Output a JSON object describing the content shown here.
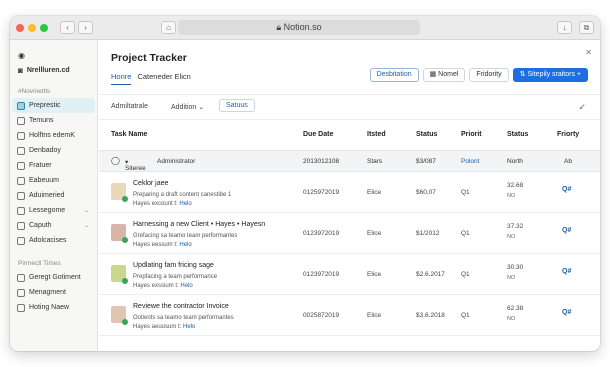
{
  "browser": {
    "url": "Notion.so",
    "lock_icon": "lock-icon"
  },
  "sidebar": {
    "workspace": "Nrellluren.cd",
    "section1": "#Novinettls",
    "items": [
      {
        "label": "Preprestic",
        "active": true
      },
      {
        "label": "Temuns"
      },
      {
        "label": "Holftns edemK"
      },
      {
        "label": "Denbadoy"
      },
      {
        "label": "Fratuer"
      },
      {
        "label": "Eabeuum"
      },
      {
        "label": "Aduimeried"
      },
      {
        "label": "Lessegome"
      },
      {
        "label": "Caputh"
      },
      {
        "label": "Adolcacises"
      }
    ],
    "section2": "Pirmectl Times",
    "items2": [
      {
        "label": "Geregt Gotiment"
      },
      {
        "label": "Menagment"
      },
      {
        "label": "Hoting Naew"
      }
    ]
  },
  "header": {
    "title": "Project Tracker",
    "views": [
      "Honre",
      "Cateneder Elicn"
    ],
    "buttons": [
      "Desbitation",
      "Nomel",
      "Fridority",
      "Sitepily sraitors +"
    ]
  },
  "toolbar": {
    "items": [
      "Admiltatrale",
      "Addition",
      "Satuus"
    ]
  },
  "table": {
    "columns": [
      "Task Name",
      "Due Date",
      "Itsted",
      "Status",
      "Priorit",
      "Status",
      "Friorty"
    ],
    "summary": {
      "name": "Siteree",
      "assignee": "Administrator",
      "date": "2013012108",
      "owner": "Stars",
      "status": "$3/087",
      "priority": "Polont",
      "status2": "North",
      "priority2": "Ab"
    },
    "rows": [
      {
        "title": "Ceklor jaee",
        "sub": "Preparing a draft content canestibe 1",
        "sub2_prefix": "Hayes excount t:",
        "sub2_link": "Helo",
        "date": "0125972019",
        "owner": "Elice",
        "status": "$60,07",
        "priority": "Q1",
        "status2_top": "32.68",
        "status2_bot": "NO",
        "priority2": "Q#",
        "thumb_color": "#e9d9b8"
      },
      {
        "title": "Harnessing a new Client • Hayes • Hayesn",
        "sub": "Grefacing sa teamo team performantes",
        "sub2_prefix": "Hayes eessum t:",
        "sub2_link": "Helo",
        "date": "0123972019",
        "owner": "Elice",
        "status": "$1/2012",
        "priority": "Q1",
        "status2_top": "37.32",
        "status2_bot": "NO",
        "priority2": "Q#",
        "thumb_color": "#d7b6a8"
      },
      {
        "title": "Updlating fam fricing sage",
        "sub": "Prepfacing a team performance",
        "sub2_prefix": "Hayes exssium t:",
        "sub2_link": "Helo",
        "date": "0123972019",
        "owner": "Elice",
        "status": "$2.6.2017",
        "priority": "Q1",
        "status2_top": "30.30",
        "status2_bot": "NO",
        "priority2": "Q#",
        "thumb_color": "#c8d98f"
      },
      {
        "title": "Reviewe the contractor Invoice",
        "sub": "Ootients sa teamo team performantes",
        "sub2_prefix": "Hayes aeuusum t:",
        "sub2_link": "Helo",
        "date": "0025872019",
        "owner": "Elice",
        "status": "$3.6.2018",
        "priority": "Q1",
        "status2_top": "62.38",
        "status2_bot": "NO",
        "priority2": "Q#",
        "thumb_color": "#e0c6b2"
      }
    ]
  },
  "colors": {
    "accent": "#1d6ee0",
    "sidebar_active": "#e1f0f4",
    "link": "#1f5fa8"
  }
}
